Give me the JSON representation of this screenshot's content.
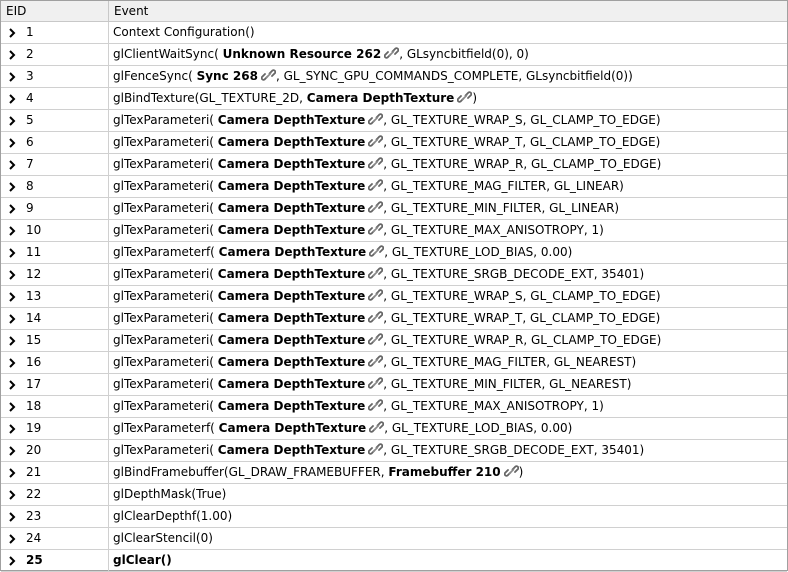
{
  "columns": {
    "eid": "EID",
    "event": "Event"
  },
  "current_eid": "25",
  "events": [
    {
      "eid": "1",
      "parts": [
        {
          "t": "Context Configuration()"
        }
      ]
    },
    {
      "eid": "2",
      "parts": [
        {
          "t": "glClientWaitSync( "
        },
        {
          "r": "Unknown Resource 262"
        },
        {
          "t": ", GLsyncbitfield(0), 0)"
        }
      ]
    },
    {
      "eid": "3",
      "parts": [
        {
          "t": "glFenceSync( "
        },
        {
          "r": "Sync 268"
        },
        {
          "t": ", GL_SYNC_GPU_COMMANDS_COMPLETE, GLsyncbitfield(0))"
        }
      ]
    },
    {
      "eid": "4",
      "parts": [
        {
          "t": "glBindTexture(GL_TEXTURE_2D,  "
        },
        {
          "r": "Camera DepthTexture"
        },
        {
          "t": ")"
        }
      ]
    },
    {
      "eid": "5",
      "parts": [
        {
          "t": "glTexParameteri( "
        },
        {
          "r": "Camera DepthTexture"
        },
        {
          "t": ", GL_TEXTURE_WRAP_S, GL_CLAMP_TO_EDGE)"
        }
      ]
    },
    {
      "eid": "6",
      "parts": [
        {
          "t": "glTexParameteri( "
        },
        {
          "r": "Camera DepthTexture"
        },
        {
          "t": ", GL_TEXTURE_WRAP_T, GL_CLAMP_TO_EDGE)"
        }
      ]
    },
    {
      "eid": "7",
      "parts": [
        {
          "t": "glTexParameteri( "
        },
        {
          "r": "Camera DepthTexture"
        },
        {
          "t": ", GL_TEXTURE_WRAP_R, GL_CLAMP_TO_EDGE)"
        }
      ]
    },
    {
      "eid": "8",
      "parts": [
        {
          "t": "glTexParameteri( "
        },
        {
          "r": "Camera DepthTexture"
        },
        {
          "t": ", GL_TEXTURE_MAG_FILTER, GL_LINEAR)"
        }
      ]
    },
    {
      "eid": "9",
      "parts": [
        {
          "t": "glTexParameteri( "
        },
        {
          "r": "Camera DepthTexture"
        },
        {
          "t": ", GL_TEXTURE_MIN_FILTER, GL_LINEAR)"
        }
      ]
    },
    {
      "eid": "10",
      "parts": [
        {
          "t": "glTexParameteri( "
        },
        {
          "r": "Camera DepthTexture"
        },
        {
          "t": ", GL_TEXTURE_MAX_ANISOTROPY, 1)"
        }
      ]
    },
    {
      "eid": "11",
      "parts": [
        {
          "t": "glTexParameterf( "
        },
        {
          "r": "Camera DepthTexture"
        },
        {
          "t": ", GL_TEXTURE_LOD_BIAS, 0.00)"
        }
      ]
    },
    {
      "eid": "12",
      "parts": [
        {
          "t": "glTexParameteri( "
        },
        {
          "r": "Camera DepthTexture"
        },
        {
          "t": ", GL_TEXTURE_SRGB_DECODE_EXT, 35401)"
        }
      ]
    },
    {
      "eid": "13",
      "parts": [
        {
          "t": "glTexParameteri( "
        },
        {
          "r": "Camera DepthTexture"
        },
        {
          "t": ", GL_TEXTURE_WRAP_S, GL_CLAMP_TO_EDGE)"
        }
      ]
    },
    {
      "eid": "14",
      "parts": [
        {
          "t": "glTexParameteri( "
        },
        {
          "r": "Camera DepthTexture"
        },
        {
          "t": ", GL_TEXTURE_WRAP_T, GL_CLAMP_TO_EDGE)"
        }
      ]
    },
    {
      "eid": "15",
      "parts": [
        {
          "t": "glTexParameteri( "
        },
        {
          "r": "Camera DepthTexture"
        },
        {
          "t": ", GL_TEXTURE_WRAP_R, GL_CLAMP_TO_EDGE)"
        }
      ]
    },
    {
      "eid": "16",
      "parts": [
        {
          "t": "glTexParameteri( "
        },
        {
          "r": "Camera DepthTexture"
        },
        {
          "t": ", GL_TEXTURE_MAG_FILTER, GL_NEAREST)"
        }
      ]
    },
    {
      "eid": "17",
      "parts": [
        {
          "t": "glTexParameteri( "
        },
        {
          "r": "Camera DepthTexture"
        },
        {
          "t": ", GL_TEXTURE_MIN_FILTER, GL_NEAREST)"
        }
      ]
    },
    {
      "eid": "18",
      "parts": [
        {
          "t": "glTexParameteri( "
        },
        {
          "r": "Camera DepthTexture"
        },
        {
          "t": ", GL_TEXTURE_MAX_ANISOTROPY, 1)"
        }
      ]
    },
    {
      "eid": "19",
      "parts": [
        {
          "t": "glTexParameterf( "
        },
        {
          "r": "Camera DepthTexture"
        },
        {
          "t": ", GL_TEXTURE_LOD_BIAS, 0.00)"
        }
      ]
    },
    {
      "eid": "20",
      "parts": [
        {
          "t": "glTexParameteri( "
        },
        {
          "r": "Camera DepthTexture"
        },
        {
          "t": ", GL_TEXTURE_SRGB_DECODE_EXT, 35401)"
        }
      ]
    },
    {
      "eid": "21",
      "parts": [
        {
          "t": "glBindFramebuffer(GL_DRAW_FRAMEBUFFER,  "
        },
        {
          "r": "Framebuffer 210"
        },
        {
          "t": ")"
        }
      ]
    },
    {
      "eid": "22",
      "parts": [
        {
          "t": "glDepthMask(True)"
        }
      ]
    },
    {
      "eid": "23",
      "parts": [
        {
          "t": "glClearDepthf(1.00)"
        }
      ]
    },
    {
      "eid": "24",
      "parts": [
        {
          "t": "glClearStencil(0)"
        }
      ]
    },
    {
      "eid": "25",
      "parts": [
        {
          "t": "glClear()"
        }
      ]
    }
  ]
}
